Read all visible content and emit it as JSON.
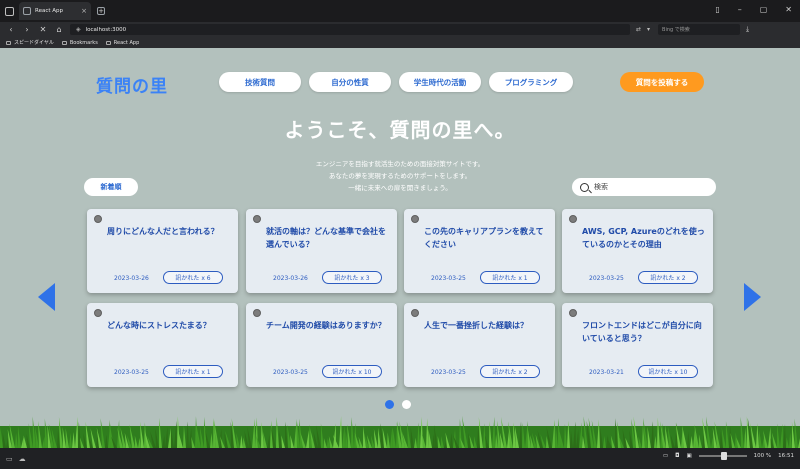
{
  "browser": {
    "tab_title": "React App",
    "url": "localhost:3000",
    "search_placeholder": "Bing で検索",
    "bookmarks": [
      "スピードダイヤル",
      "Bookmarks",
      "React App"
    ]
  },
  "site": {
    "logo": "質問の里",
    "nav": [
      "技術質問",
      "自分の性質",
      "学生時代の活動",
      "プログラミング"
    ],
    "post_button": "質問を投稿する",
    "hero_title": "ようこそ、質問の里へ。",
    "hero_lines": [
      "エンジニアを目指す就活生のための面接対策サイトです。",
      "あなたの夢を実現するためのサポートをします。",
      "一緒に未来への扉を開きましょう。"
    ],
    "sort_label": "新着順",
    "search_placeholder": "検索"
  },
  "cards": [
    {
      "question": "周りにどんな人だと言われる？",
      "date": "2023-03-26",
      "asked": "訊かれた x 6"
    },
    {
      "question": "就活の軸は？どんな基準で会社を選んでいる？",
      "date": "2023-03-26",
      "asked": "訊かれた x 3"
    },
    {
      "question": "この先のキャリアプランを教えてください",
      "date": "2023-03-25",
      "asked": "訊かれた x 1"
    },
    {
      "question": "AWS, GCP, Azureのどれを使っているのかとその理由",
      "date": "2023-03-25",
      "asked": "訊かれた x 2"
    },
    {
      "question": "どんな時にストレスたまる？",
      "date": "2023-03-25",
      "asked": "訊かれた x 1"
    },
    {
      "question": "チーム開発の経験はありますか？",
      "date": "2023-03-25",
      "asked": "訊かれた x 10"
    },
    {
      "question": "人生で一番挫折した経験は？",
      "date": "2023-03-25",
      "asked": "訊かれた x 2"
    },
    {
      "question": "フロントエンドはどこが自分に向いていると思う？",
      "date": "2023-03-21",
      "asked": "訊かれた x 10"
    }
  ],
  "taskbar": {
    "zoom": "100 %",
    "time": "16:51"
  },
  "colors": {
    "accent": "#2f72e8",
    "post": "#ff9a1f",
    "background": "#b3c1bd"
  }
}
